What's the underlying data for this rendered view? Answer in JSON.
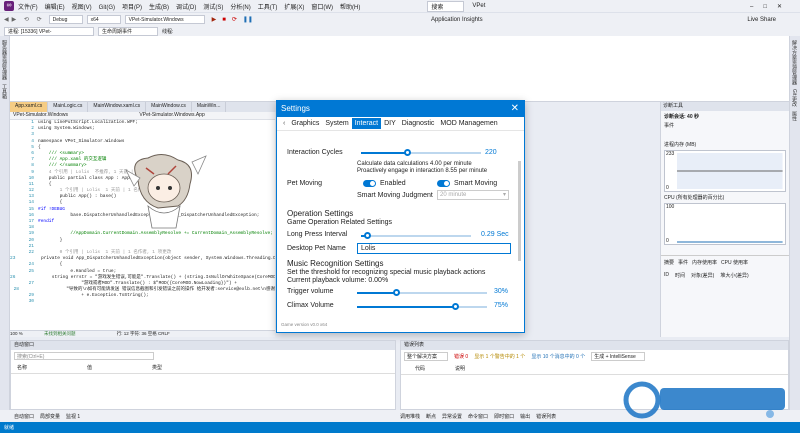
{
  "titlebar": {
    "menu": [
      "文件(F)",
      "编辑(E)",
      "视图(V)",
      "Git(G)",
      "项目(P)",
      "生成(B)",
      "调试(D)",
      "测试(S)",
      "分析(N)",
      "工具(T)",
      "扩展(X)",
      "窗口(W)",
      "帮助(H)"
    ],
    "search": "搜索",
    "app_name": "VPet"
  },
  "toolbar": {
    "config": "Debug",
    "platform": "x64",
    "startup": "VPet-Simulator.Windows",
    "app_insights": "Application Insights",
    "live_share": "Live Share"
  },
  "toolbar2": {
    "process": "进程: [15336] VPet-Simulator.Windows",
    "lifecycle": "生命周期事件",
    "thread": "线程:"
  },
  "tabs": [
    "App.xaml.cs",
    "MainLogic.cs",
    "MainWindow.xaml.cs",
    "MainWindow.cs",
    "MainWin..."
  ],
  "editor": {
    "nav_left": "VPet-Simulator.Windows",
    "nav_right": "VPet-Simulator.Windows.App",
    "lines": [
      {
        "n": "1",
        "t": "using LinePutScript.Localization.WPF;"
      },
      {
        "n": "2",
        "t": "using System.Windows;"
      },
      {
        "n": "3",
        "t": ""
      },
      {
        "n": "4",
        "t": "namespace VPet_Simulator.Windows"
      },
      {
        "n": "5",
        "t": "{"
      },
      {
        "n": "6",
        "t": "    /// <summary>"
      },
      {
        "n": "7",
        "t": "    /// App.xaml 的交互逻辑"
      },
      {
        "n": "8",
        "t": "    /// </summary>"
      },
      {
        "n": "9",
        "t": "    4 个引用 | Lolis  不推荐, 1 天前 | 3 名作者, 4 项更改"
      },
      {
        "n": "10",
        "t": "    public partial class App : Application"
      },
      {
        "n": "11",
        "t": "    {"
      },
      {
        "n": "12",
        "t": "        1 个引用 | Lolis  1 天前 | 1 名作者, 1 项更改"
      },
      {
        "n": "13",
        "t": "        public App() : base()"
      },
      {
        "n": "14",
        "t": "        {"
      },
      {
        "n": "15",
        "t": "#if !DEBUG"
      },
      {
        "n": "16",
        "t": "            base.DispatcherUnhandledException += App_DispatcherUnhandledException;"
      },
      {
        "n": "17",
        "t": "#endif"
      },
      {
        "n": "18",
        "t": ""
      },
      {
        "n": "19",
        "t": "            //AppDomain.CurrentDomain.AssemblyResolve += CurrentDomain_AssemblyResolve;"
      },
      {
        "n": "20",
        "t": "        }"
      },
      {
        "n": "21",
        "t": ""
      },
      {
        "n": "22",
        "t": "        0 个引用 | Lolis  1 天前 | 1 名作者, 1 项更改"
      },
      {
        "n": "23",
        "t": "        private void App_DispatcherUnhandledException(object sender, System.Windows.Threading.Dispat"
      },
      {
        "n": "24",
        "t": "        {"
      },
      {
        "n": "25",
        "t": "            e.Handled = true;"
      },
      {
        "n": "26",
        "t": "            string errstr = \"游戏发生错误,可能是\".Translate() + (string.IsNullOrWhiteSpace(CoreMOD.NowLoading)"
      },
      {
        "n": "27",
        "t": "                \"游戏或者MOD\".Translate() : $\"MOD({CoreMOD.NowLoading})\") +"
      },
      {
        "n": "28",
        "t": "                \"导致的\\n如有可能请发送 错误信息截图和引发错误之前的操作 给开发者:service@exlb.net\\n感谢"
      },
      {
        "n": "29",
        "t": "                + e.Exception.ToString();"
      },
      {
        "n": "30",
        "t": ""
      }
    ]
  },
  "editor_status": {
    "zoom": "100 %",
    "issues": "未找到相关问题",
    "pos": "行: 12  字符: 36  空格  CRLF"
  },
  "settings": {
    "title": "Settings",
    "tabs": [
      "Graphics",
      "System",
      "Interact",
      "DIY",
      "Diagnostic",
      "MOD Managemen"
    ],
    "active_tab": "Interact",
    "interaction_cycles_label": "Interaction Cycles",
    "interaction_cycles_value": "220",
    "interaction_cycles_fraction": 0.38,
    "calc_text": "Calculate data calculations 4.00 per minute",
    "engage_text": "Proactively engage in interaction 8.55 per minute",
    "pet_moving": "Pet Moving",
    "enabled": "Enabled",
    "smart_moving": "Smart Moving",
    "judgment_label": "Smart Moving Judgment",
    "judgment_value": "20 minute",
    "op_title": "Operation Settings",
    "op_sub": "Game Operation Related Settings",
    "long_press_label": "Long Press Interval",
    "long_press_value": "0.29 Sec",
    "long_press_fraction": 0.05,
    "pet_name_label": "Desktop Pet Name",
    "pet_name_value": "Lolis",
    "music_title": "Music Recognition Settings",
    "music_sub": "Set the threshold for recognizing special music playback actions",
    "music_current": "Current playback volume: 0.00%",
    "trigger_label": "Trigger volume",
    "trigger_value": "30%",
    "trigger_fraction": 0.3,
    "climax_label": "Climax Volume",
    "climax_value": "75%",
    "climax_fraction": 0.75,
    "footer": "Game version v0.0 x64"
  },
  "diagnostics": {
    "title": "诊断工具",
    "session": "诊断会话: 40 秒",
    "events": "事件",
    "memory": "进程内存 (MB)",
    "mem_top": "233",
    "mem_bottom": "0",
    "cpu": "CPU (所有处理器的百分比)",
    "cpu_top": "100",
    "cpu_bottom": "0",
    "tabs": [
      "摘要",
      "事件",
      "内存使用率",
      "CPU 使用率"
    ],
    "cols": [
      "ID",
      "时间",
      "对象(差异)",
      "堆大小(差异)"
    ]
  },
  "output": {
    "title": "自动窗口",
    "search": "搜索(Ctrl+E)",
    "cols": [
      "名称",
      "值",
      "类型"
    ]
  },
  "errors": {
    "title": "错误列表",
    "scope": "整个解决方案",
    "err": "错误 0",
    "warn": "显示 1 个警告中的 1 个",
    "msg": "显示 10 个消息中的 0 个",
    "build": "生成 + IntelliSense",
    "cols": [
      "代码",
      "说明"
    ]
  },
  "bottom_tabs": [
    "自动窗口",
    "局部变量",
    "监视 1"
  ],
  "bottom_tabs_right": [
    "调用堆栈",
    "断点",
    "异常设置",
    "命令窗口",
    "即时窗口",
    "输出",
    "错误列表"
  ],
  "statusbar": {
    "text": "就绪"
  },
  "colors": {
    "accent": "#0078d4",
    "vs_blue": "#007acc"
  }
}
